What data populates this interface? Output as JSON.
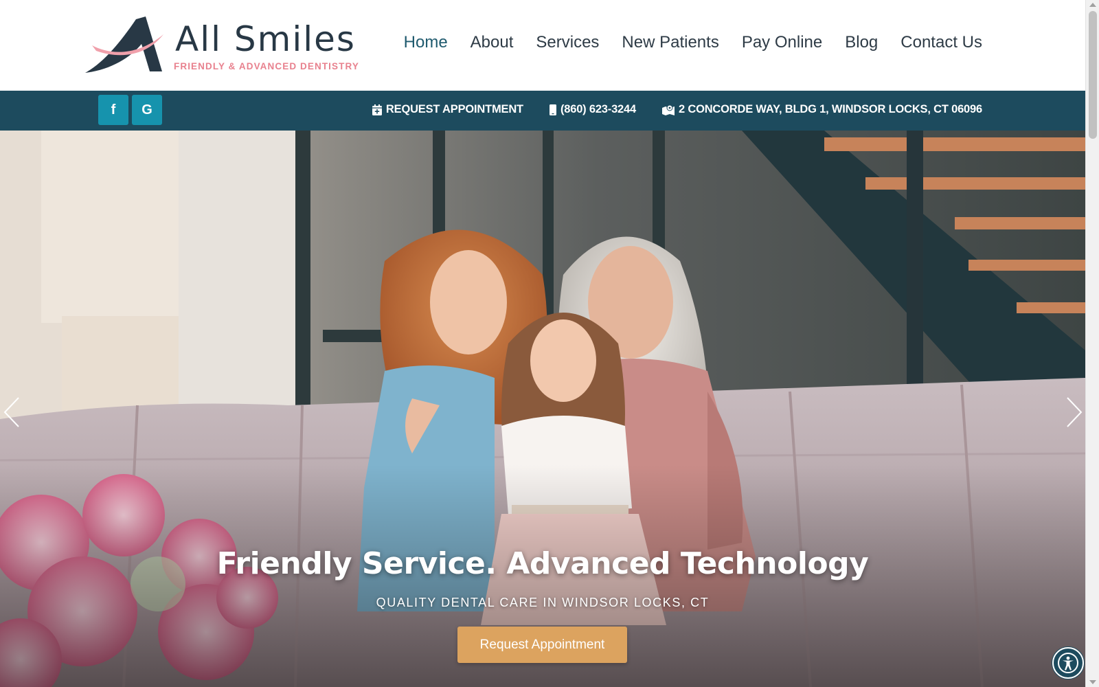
{
  "brand": {
    "name": "All Smiles",
    "tagline": "FRIENDLY & ADVANCED DENTISTRY",
    "colors": {
      "navy": "#283845",
      "pink": "#e8818e"
    }
  },
  "nav": {
    "items": [
      {
        "label": "Home",
        "active": true
      },
      {
        "label": "About"
      },
      {
        "label": "Services"
      },
      {
        "label": "New Patients"
      },
      {
        "label": "Pay Online"
      },
      {
        "label": "Blog"
      },
      {
        "label": "Contact Us"
      }
    ]
  },
  "infobar": {
    "background": "#1d4b5e",
    "social": [
      {
        "icon": "facebook-icon",
        "glyph": "f"
      },
      {
        "icon": "google-icon",
        "glyph": "G"
      }
    ],
    "request_appointment": "REQUEST APPOINTMENT",
    "phone": "(860) 623-3244",
    "address": "2 CONCORDE WAY, BLDG 1, WINDSOR LOCKS, CT 06096"
  },
  "hero": {
    "title": "Friendly Service. Advanced Technology",
    "subtitle": "QUALITY DENTAL CARE IN WINDSOR LOCKS, CT",
    "button": "Request Appointment",
    "button_color": "#dca35f",
    "prev_icon": "chevron-left-icon",
    "next_icon": "chevron-right-icon"
  },
  "accessibility": {
    "icon": "accessibility-icon"
  }
}
